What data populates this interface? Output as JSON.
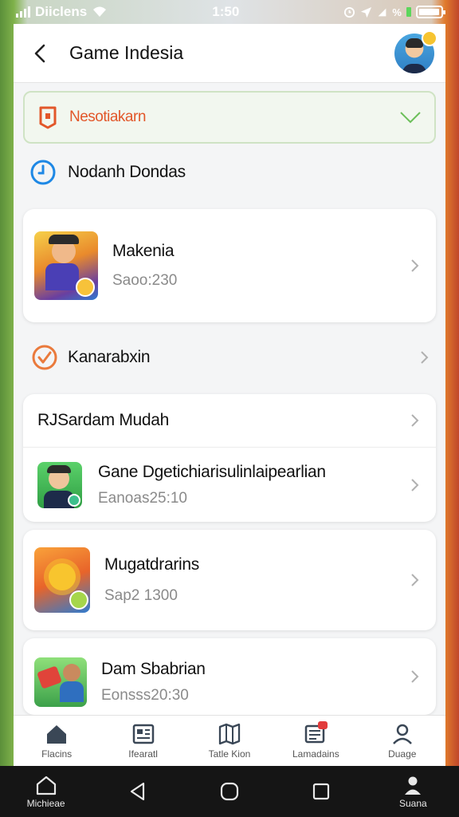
{
  "status_bar": {
    "carrier": "Diiclens",
    "time": "1:50",
    "battery_level": 0.95
  },
  "header": {
    "title": "Game Indesia"
  },
  "filter": {
    "label": "Nesotiakarn"
  },
  "section": {
    "title": "Nodanh Dondas"
  },
  "featured": {
    "title": "Makenia",
    "subtitle": "Saoo:230"
  },
  "plain_row": {
    "title": "Kanarabxin"
  },
  "group": {
    "header": "RJSardam Mudah",
    "item": {
      "title": "Gane Dgetichiarisulinlaipearlian",
      "subtitle": "Eanoas25:10"
    }
  },
  "items": [
    {
      "title": "Mugatdrarins",
      "subtitle": "Sap2 1300"
    },
    {
      "title": "Dam Sbabrian",
      "subtitle": "Eonsss20:30"
    }
  ],
  "bottom_nav": {
    "items": [
      {
        "label": "Flacins",
        "icon": "home-icon"
      },
      {
        "label": "Ifearatl",
        "icon": "newspaper-icon"
      },
      {
        "label": "Tatle Kion",
        "icon": "map-icon"
      },
      {
        "label": "Lamadains",
        "icon": "message-icon"
      },
      {
        "label": "Duage",
        "icon": "profile-icon"
      }
    ]
  },
  "system_nav": {
    "left_label": "Michieae",
    "right_label": "Suana"
  },
  "colors": {
    "accent_orange": "#e2572a",
    "accent_blue": "#1e88e5",
    "filter_bg": "#f2f7ef",
    "filter_border": "#cfe3c4"
  }
}
